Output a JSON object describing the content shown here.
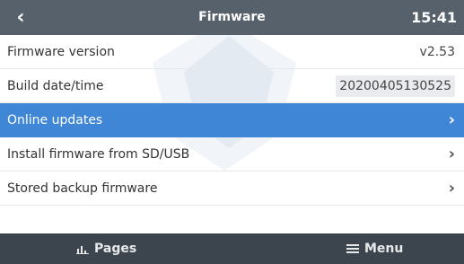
{
  "header": {
    "back_icon": "back-arrow-icon",
    "title": "Firmware",
    "time": "15:41"
  },
  "list": {
    "items": [
      {
        "label": "Firmware version",
        "value": "v2.53",
        "type": "value"
      },
      {
        "label": "Build date/time",
        "value": "20200405130525",
        "type": "value"
      },
      {
        "label": "Online updates",
        "type": "submenu",
        "selected": true
      },
      {
        "label": "Install firmware from SD/USB",
        "type": "submenu"
      },
      {
        "label": "Stored backup firmware",
        "type": "submenu"
      }
    ]
  },
  "footer": {
    "pages_label": "Pages",
    "pages_icon": "pages-icon",
    "menu_label": "Menu",
    "menu_icon": "hamburger-menu-icon"
  },
  "colors": {
    "titlebar": "#56616c",
    "selected_row": "#3f87d6",
    "bottombar": "#3c454e"
  }
}
